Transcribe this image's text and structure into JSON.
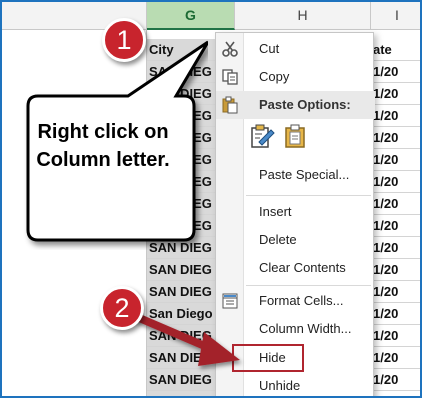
{
  "sheet": {
    "columns": [
      {
        "letter": "G",
        "selected": true
      },
      {
        "letter": "H",
        "selected": false
      },
      {
        "letter": "I",
        "selected": false
      }
    ],
    "rows": [
      {
        "g": "City",
        "h": "",
        "i": "ate"
      },
      {
        "g": "SAN DIEG",
        "h": "",
        "i": "1/20"
      },
      {
        "g": "SAN DIEG",
        "h": "",
        "i": "1/20"
      },
      {
        "g": "SAN DIEG",
        "h": "",
        "i": "1/20"
      },
      {
        "g": "SAN DIEG",
        "h": "",
        "i": "1/20"
      },
      {
        "g": "SAN DIEG",
        "h": "",
        "i": "1/20"
      },
      {
        "g": "SAN DIEG",
        "h": "",
        "i": "1/20"
      },
      {
        "g": "SAN DIEG",
        "h": "",
        "i": "1/20"
      },
      {
        "g": "SAN DIEG",
        "h": "",
        "i": "1/20"
      },
      {
        "g": "SAN DIEG",
        "h": "",
        "i": "1/20"
      },
      {
        "g": "SAN DIEG",
        "h": "",
        "i": "1/20"
      },
      {
        "g": "SAN DIEG",
        "h": "",
        "i": "1/20"
      },
      {
        "g": "San Diego",
        "h": "",
        "i": "1/20"
      },
      {
        "g": "SAN DIEG",
        "h": "",
        "i": "1/20"
      },
      {
        "g": "SAN DIEG",
        "h": "",
        "i": "1/20"
      },
      {
        "g": "SAN DIEG",
        "h": "",
        "i": "1/20"
      },
      {
        "g": "SAN DIEG",
        "h": "",
        "i": "1/20"
      }
    ]
  },
  "context_menu": {
    "cut": "Cut",
    "copy": "Copy",
    "paste_options": "Paste Options:",
    "paste_special": "Paste Special...",
    "insert": "Insert",
    "delete": "Delete",
    "clear_contents": "Clear Contents",
    "format_cells": "Format Cells...",
    "column_width": "Column Width...",
    "hide": "Hide",
    "unhide": "Unhide"
  },
  "annotations": {
    "step1": "1",
    "step2": "2",
    "callout_text": "Right click on Column letter.",
    "accent_color": "#c8242d",
    "arrow_color": "#a3232b"
  },
  "icons": {
    "cut": "scissors-icon",
    "copy": "copy-icon",
    "paste": "clipboard-icon",
    "paste_format": "paste-formatting-icon",
    "format_cells": "format-cells-icon"
  }
}
